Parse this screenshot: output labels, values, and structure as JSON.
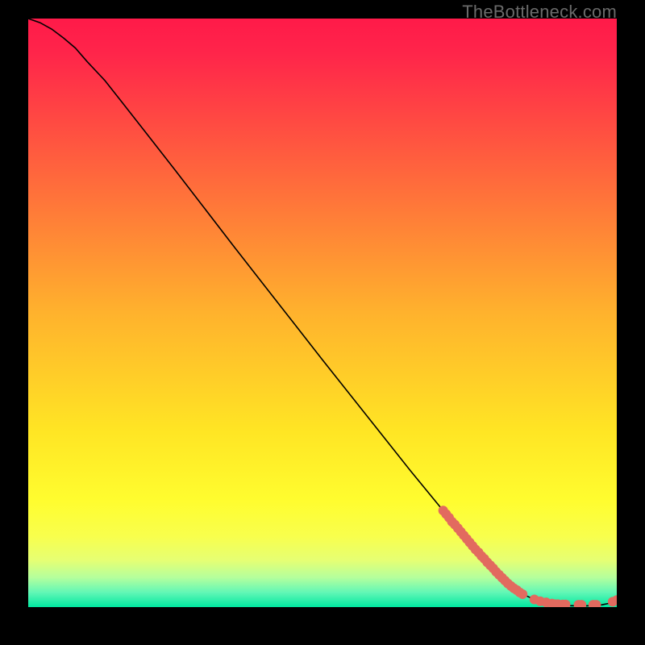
{
  "watermark": "TheBottleneck.com",
  "chart_data": {
    "type": "line",
    "title": "",
    "xlabel": "",
    "ylabel": "",
    "xlim": [
      0,
      100
    ],
    "ylim": [
      0,
      100
    ],
    "grid": false,
    "background_gradient": {
      "stops": [
        {
          "offset": 0.0,
          "color": "#ff1a49"
        },
        {
          "offset": 0.06,
          "color": "#ff254a"
        },
        {
          "offset": 0.5,
          "color": "#ffb22d"
        },
        {
          "offset": 0.7,
          "color": "#ffe524"
        },
        {
          "offset": 0.82,
          "color": "#fffd2f"
        },
        {
          "offset": 0.88,
          "color": "#f8ff4d"
        },
        {
          "offset": 0.92,
          "color": "#e6ff73"
        },
        {
          "offset": 0.95,
          "color": "#b4ff9d"
        },
        {
          "offset": 0.975,
          "color": "#62f7b6"
        },
        {
          "offset": 1.0,
          "color": "#00e8a0"
        }
      ]
    },
    "series": [
      {
        "name": "bottleneck-curve",
        "color": "#000000",
        "x": [
          0,
          2,
          4,
          6,
          8,
          10,
          13,
          16,
          20,
          25,
          30,
          35,
          40,
          45,
          50,
          55,
          60,
          65,
          70,
          73,
          75,
          78,
          80,
          82,
          84,
          86,
          88,
          90,
          92,
          94,
          96,
          97.5,
          98.5,
          99.2,
          100
        ],
        "y": [
          100,
          99.3,
          98.2,
          96.7,
          95.0,
          92.7,
          89.5,
          85.7,
          80.6,
          74.2,
          67.7,
          61.2,
          54.8,
          48.4,
          42.0,
          35.7,
          29.4,
          23.1,
          17.0,
          13.3,
          11.0,
          7.6,
          5.5,
          3.6,
          2.2,
          1.3,
          0.7,
          0.4,
          0.25,
          0.2,
          0.25,
          0.4,
          0.6,
          0.85,
          1.2
        ]
      },
      {
        "name": "sample-points",
        "type": "scatter",
        "color": "#e26a5f",
        "radius": 6,
        "x": [
          70.5,
          71.0,
          71.5,
          72.0,
          72.5,
          73.0,
          73.5,
          74.0,
          74.5,
          75.0,
          75.5,
          76.0,
          76.5,
          77.0,
          77.5,
          78.0,
          78.5,
          79.0,
          79.5,
          80.0,
          80.5,
          81.0,
          81.5,
          82.0,
          82.5,
          83.0,
          83.5,
          84.0,
          86.0,
          87.0,
          88.0,
          89.0,
          89.5,
          90.0,
          90.8,
          91.3,
          93.5,
          94.0,
          96.0,
          96.5,
          99.3,
          100.0
        ],
        "y": [
          16.4,
          15.8,
          15.2,
          14.5,
          14.0,
          13.4,
          12.8,
          12.2,
          11.6,
          11.0,
          10.4,
          9.8,
          9.3,
          8.7,
          8.2,
          7.6,
          7.1,
          6.6,
          6.0,
          5.5,
          5.0,
          4.5,
          4.0,
          3.6,
          3.2,
          2.9,
          2.5,
          2.2,
          1.3,
          1.0,
          0.8,
          0.6,
          0.5,
          0.5,
          0.45,
          0.45,
          0.4,
          0.4,
          0.4,
          0.4,
          0.9,
          1.2
        ]
      }
    ]
  }
}
